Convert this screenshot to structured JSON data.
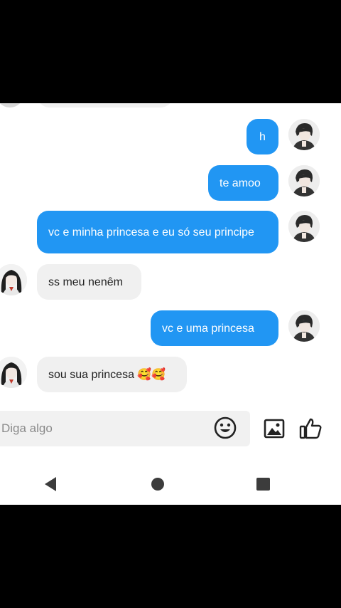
{
  "messages": [
    {
      "from": "me",
      "text": "h"
    },
    {
      "from": "me",
      "text": "te amoo"
    },
    {
      "from": "me",
      "text": "vc e minha princesa e eu só seu principe"
    },
    {
      "from": "them",
      "text": "ss meu nenêm"
    },
    {
      "from": "me",
      "text": "vc e uma princesa"
    },
    {
      "from": "them",
      "text": "sou sua princesa 🥰🥰"
    }
  ],
  "composer": {
    "placeholder": "Diga algo"
  },
  "icons": {
    "emoji": "smiley-icon",
    "image": "image-icon",
    "like": "thumbs-up-icon",
    "back": "back-triangle-icon",
    "home": "home-circle-icon",
    "recent": "recent-square-icon"
  },
  "colors": {
    "my_bubble": "#2196f3",
    "their_bubble": "#f0f0f0",
    "background": "#ffffff",
    "letterbox": "#000000"
  }
}
